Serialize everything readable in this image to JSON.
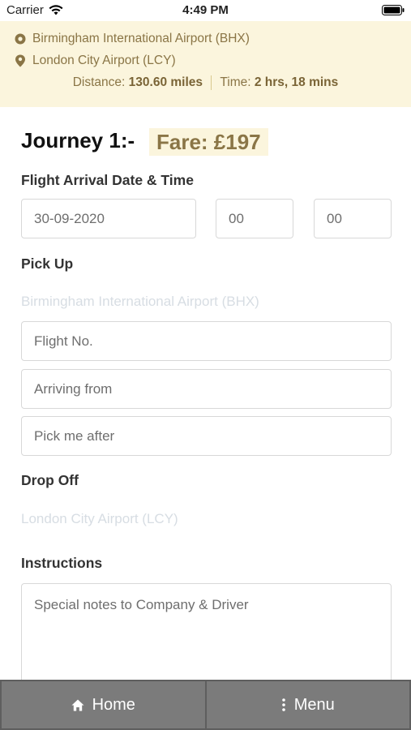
{
  "status_bar": {
    "carrier": "Carrier",
    "time": "4:49 PM"
  },
  "route": {
    "from": "Birmingham International Airport (BHX)",
    "to": "London City Airport (LCY)",
    "distance_label": "Distance:",
    "distance_value": "130.60 miles",
    "time_label": "Time:",
    "time_value": "2 hrs, 18 mins"
  },
  "journey": {
    "title": "Journey 1:-",
    "fare": "Fare: £197"
  },
  "arrival": {
    "label": "Flight Arrival Date & Time",
    "date": "30-09-2020",
    "hour": "00",
    "minute": "00"
  },
  "pickup": {
    "label": "Pick Up",
    "location": "Birmingham International Airport (BHX)",
    "flight_no_placeholder": "Flight No.",
    "arriving_from_placeholder": "Arriving from",
    "pick_me_after_placeholder": "Pick me after"
  },
  "dropoff": {
    "label": "Drop Off",
    "location": "London City Airport (LCY)"
  },
  "instructions": {
    "label": "Instructions",
    "placeholder": "Special notes to Company & Driver"
  },
  "nav": {
    "home_label": "Home",
    "menu_label": "Menu"
  },
  "colors": {
    "accent": "#8a7546",
    "panel": "#fbf5dd",
    "nav": "#7b7b7b"
  }
}
